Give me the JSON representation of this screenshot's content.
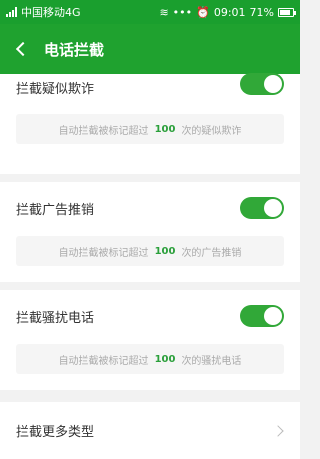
{
  "status_bar": {
    "carrier": "中国移动4G",
    "time": "09:01",
    "battery": "71%"
  },
  "app_bar": {
    "title": "电话拦截"
  },
  "settings": [
    {
      "label": "拦截疑似欺诈",
      "enabled": true,
      "desc_prefix": "自动拦截被标记超过",
      "count": "100",
      "desc_suffix": "次的疑似欺诈"
    },
    {
      "label": "拦截广告推销",
      "enabled": true,
      "desc_prefix": "自动拦截被标记超过",
      "count": "100",
      "desc_suffix": "次的广告推销"
    },
    {
      "label": "拦截骚扰电话",
      "enabled": true,
      "desc_prefix": "自动拦截被标记超过",
      "count": "100",
      "desc_suffix": "次的骚扰电话"
    }
  ],
  "more_types": {
    "label": "拦截更多类型"
  }
}
